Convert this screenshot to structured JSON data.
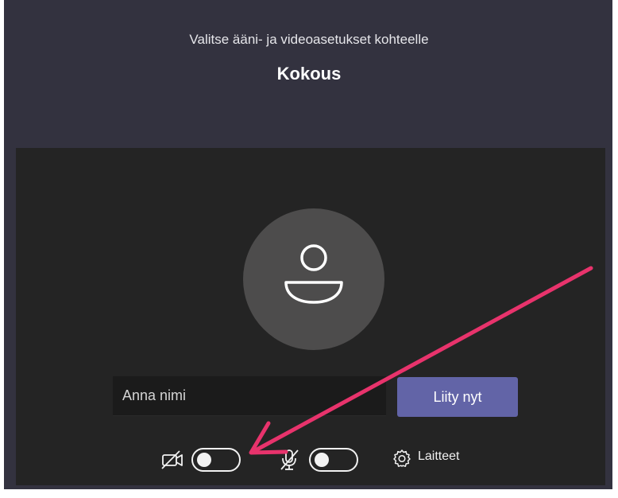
{
  "header": {
    "subtitle": "Valitse ääni- ja videoasetukset kohteelle",
    "title": "Kokous"
  },
  "join": {
    "name_placeholder": "Anna nimi",
    "name_value": "",
    "join_label": "Liity nyt"
  },
  "controls": {
    "camera_icon": "video-off-icon",
    "camera_toggle_on": false,
    "mic_icon": "mic-off-icon",
    "mic_toggle_on": false,
    "devices_icon": "gear-icon",
    "devices_label": "Laitteet"
  },
  "colors": {
    "background": "#33323f",
    "panel": "#242424",
    "accent": "#6264a7",
    "annotation_arrow": "#e8336c"
  }
}
